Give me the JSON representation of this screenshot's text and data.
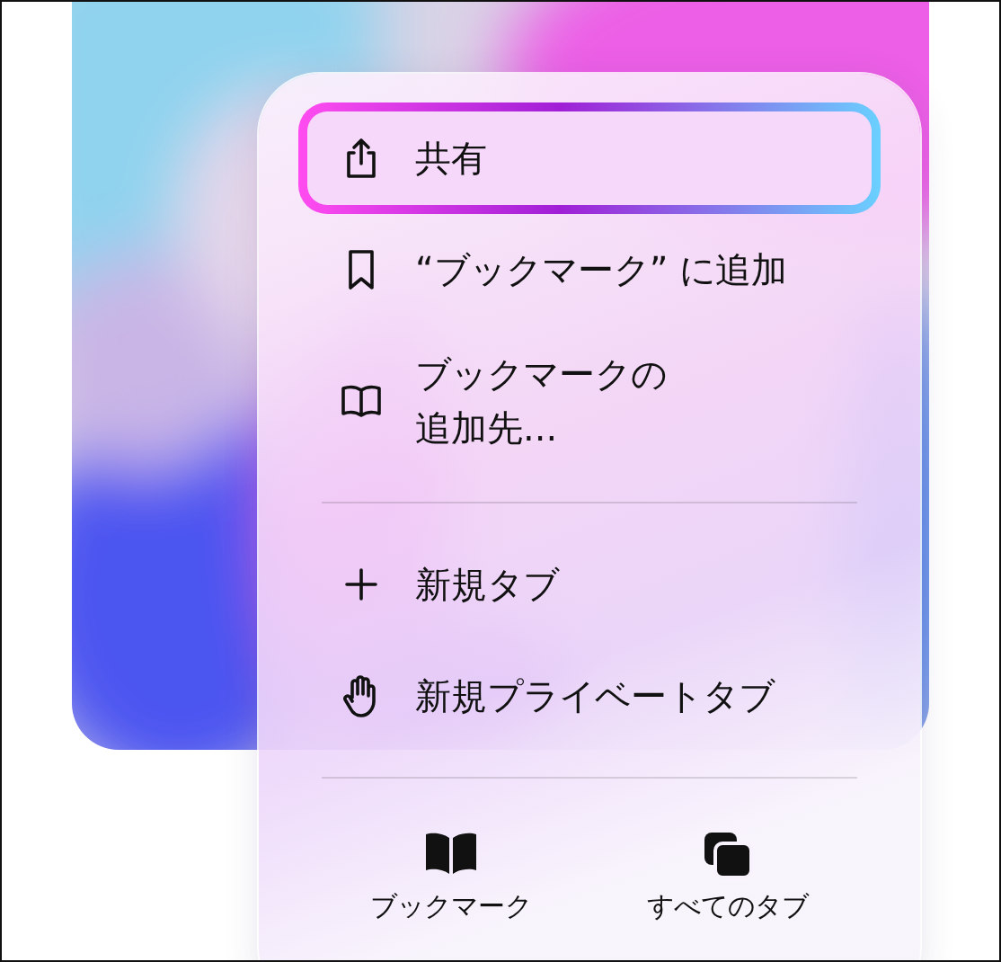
{
  "menu": {
    "items": [
      {
        "kind": "share",
        "label": "共有",
        "selected": true
      },
      {
        "kind": "bookmark",
        "label": "“ブックマーク” に追加",
        "selected": false
      },
      {
        "kind": "book",
        "label": "ブックマークの追加先...",
        "selected": false
      },
      {
        "kind": "divider"
      },
      {
        "kind": "plus",
        "label": "新規タブ",
        "selected": false
      },
      {
        "kind": "hand",
        "label": "新規プライベートタブ",
        "selected": false
      },
      {
        "kind": "divider"
      }
    ],
    "bottom_buttons": [
      {
        "kind": "book",
        "label": "ブックマーク"
      },
      {
        "kind": "tabs",
        "label": "すべてのタブ"
      }
    ]
  }
}
